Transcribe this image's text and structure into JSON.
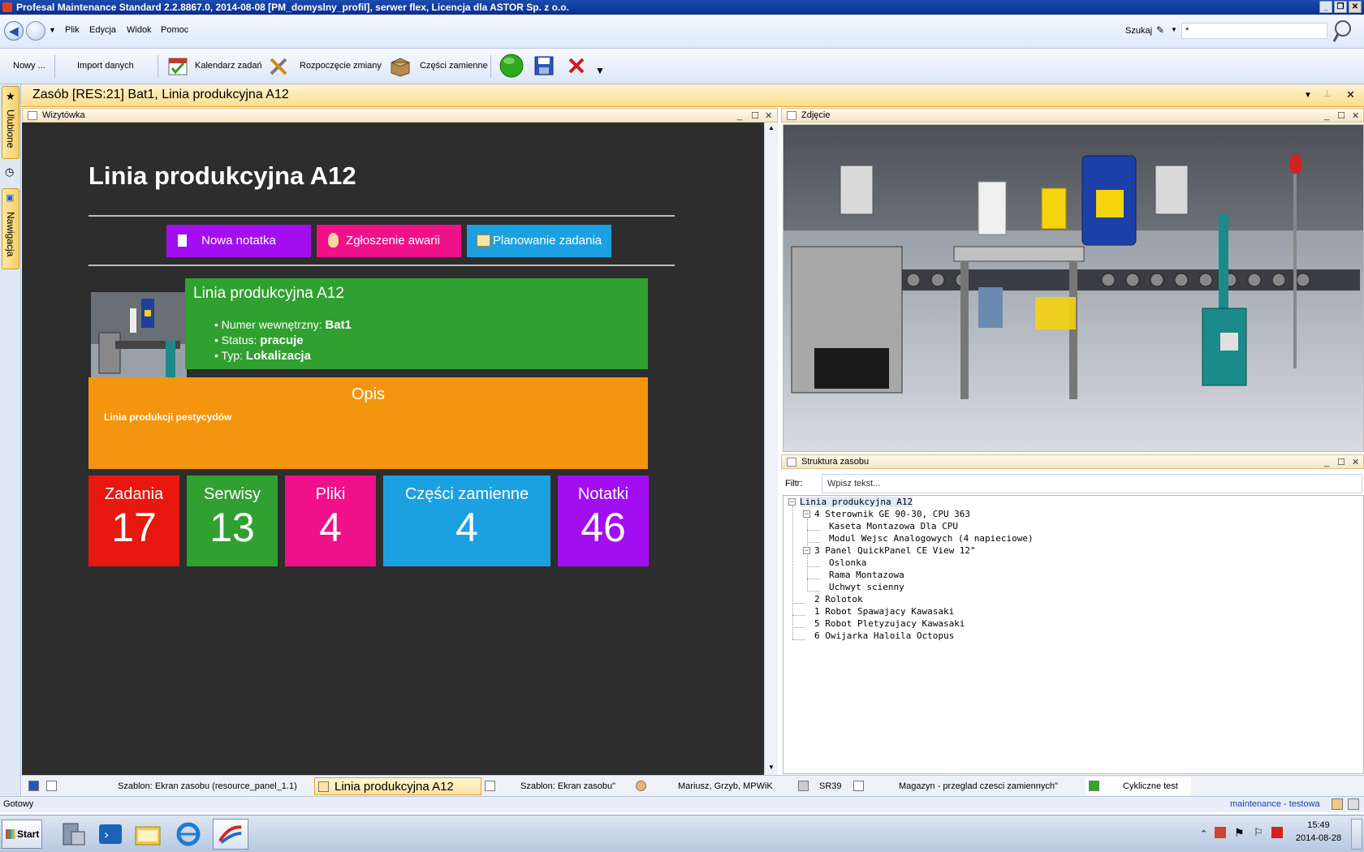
{
  "window": {
    "title": "Profesal Maintenance Standard 2.2.8867.0, 2014-08-08 [PM_domyslny_profil], serwer flex, Licencja dla ASTOR Sp. z o.o."
  },
  "menu": {
    "items": [
      "Plik",
      "Edycja",
      "Widok",
      "Pomoc"
    ]
  },
  "search": {
    "label": "Szukaj",
    "value": "*"
  },
  "toolbar": {
    "new_label": "Nowy ...",
    "import_label": "Import danych",
    "calendar_label": "Kalendarz zadań",
    "shift_label": "Rozpoczęcie zmiany",
    "parts_label": "Części zamienne"
  },
  "sidebar": {
    "favorites": "Ulubione",
    "navigation": "Nawigacja"
  },
  "document": {
    "title": "Zasób [RES:21] Bat1, Linia produkcyjna A12"
  },
  "wizytowka": {
    "panel_title": "Wizytówka",
    "heading": "Linia produkcyjna A12",
    "buttons": {
      "note": "Nowa notatka",
      "failure": "Zgłoszenie awarii",
      "plan": "Planowanie zadania"
    },
    "info": {
      "name": "Linia produkcyjna A12",
      "internal_label": "Numer wewnętrzny:",
      "internal_value": "Bat1",
      "status_label": "Status:",
      "status_value": "pracuje",
      "type_label": "Typ:",
      "type_value": "Lokalizacja"
    },
    "description": {
      "title": "Opis",
      "text": "Linia produkcji pestycydów"
    },
    "tiles": [
      {
        "label": "Zadania",
        "value": "17",
        "color": "#e8170f"
      },
      {
        "label": "Serwisy",
        "value": "13",
        "color": "#30a030"
      },
      {
        "label": "Pliki",
        "value": "4",
        "color": "#f0108a"
      },
      {
        "label": "Części zamienne",
        "value": "4",
        "color": "#1ba1e2"
      },
      {
        "label": "Notatki",
        "value": "46",
        "color": "#a20ef0"
      }
    ]
  },
  "photo": {
    "panel_title": "Zdjęcie"
  },
  "structure": {
    "panel_title": "Struktura zasobu",
    "filter_label": "Filtr:",
    "filter_placeholder": "Wpisz tekst...",
    "tree": [
      "Linia produkcyjna A12",
      "4 Sterownik GE 90-30, CPU 363",
      "Kaseta Montazowa Dla CPU",
      "Modul Wejsc Analogowych (4 napieciowe)",
      "3 Panel QuickPanel CE View 12\"",
      "Oslonka",
      "Rama Montazowa",
      "Uchwyt scienny",
      "2 Rolotok",
      "1 Robot Spawajacy Kawasaki",
      "5 Robot Pletyzujacy Kawasaki",
      "6 Owijarka Haloila Octopus"
    ]
  },
  "doc_tabs": [
    "Szablon: Ekran zasobu (resource_panel_1.1)",
    "Linia produkcyjna A12",
    "Szablon: Ekran zasobu\"",
    "Mariusz, Grzyb, MPWiK",
    "SR39",
    "Magazyn - przeglad czesci zamiennych\"",
    "Cykliczne test"
  ],
  "status": {
    "left": "Gotowy",
    "right": "maintenance - testowa"
  },
  "taskbar": {
    "start": "Start",
    "time": "15:49",
    "date": "2014-08-28"
  },
  "colors": {
    "purple": "#a20ef0",
    "pink": "#f0108a",
    "blue": "#1ba1e2",
    "green": "#30a030",
    "orange": "#f3950e",
    "dark": "#2d2d2d"
  }
}
